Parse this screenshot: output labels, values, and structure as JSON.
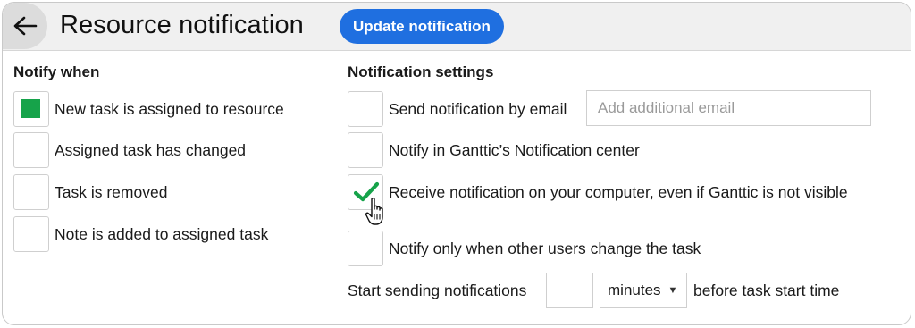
{
  "header": {
    "title": "Resource notification",
    "update_button": "Update notification",
    "back_icon": "arrow-left-icon"
  },
  "notify_when": {
    "title": "Notify when",
    "items": [
      {
        "label": "New task is assigned to resource",
        "checked": true
      },
      {
        "label": "Assigned task has changed",
        "checked": false
      },
      {
        "label": "Task is removed",
        "checked": false
      },
      {
        "label": "Note is added to assigned task",
        "checked": false
      }
    ]
  },
  "notification_settings": {
    "title": "Notification settings",
    "email_label": "Send notification by email",
    "email_placeholder": "Add additional email",
    "email_checked": false,
    "center_label": "Notify in Ganttic’s Notification center",
    "center_checked": false,
    "computer_label": "Receive notification on your computer, even if Ganttic is not visible",
    "computer_checked": true,
    "others_label": "Notify only when other users change the task",
    "others_checked": false,
    "start_label": "Start sending notifications",
    "start_value": "",
    "unit_selected": "minutes",
    "after_label": "before task start time"
  },
  "colors": {
    "accent": "#1f6fe0",
    "check_green": "#16a34a"
  }
}
